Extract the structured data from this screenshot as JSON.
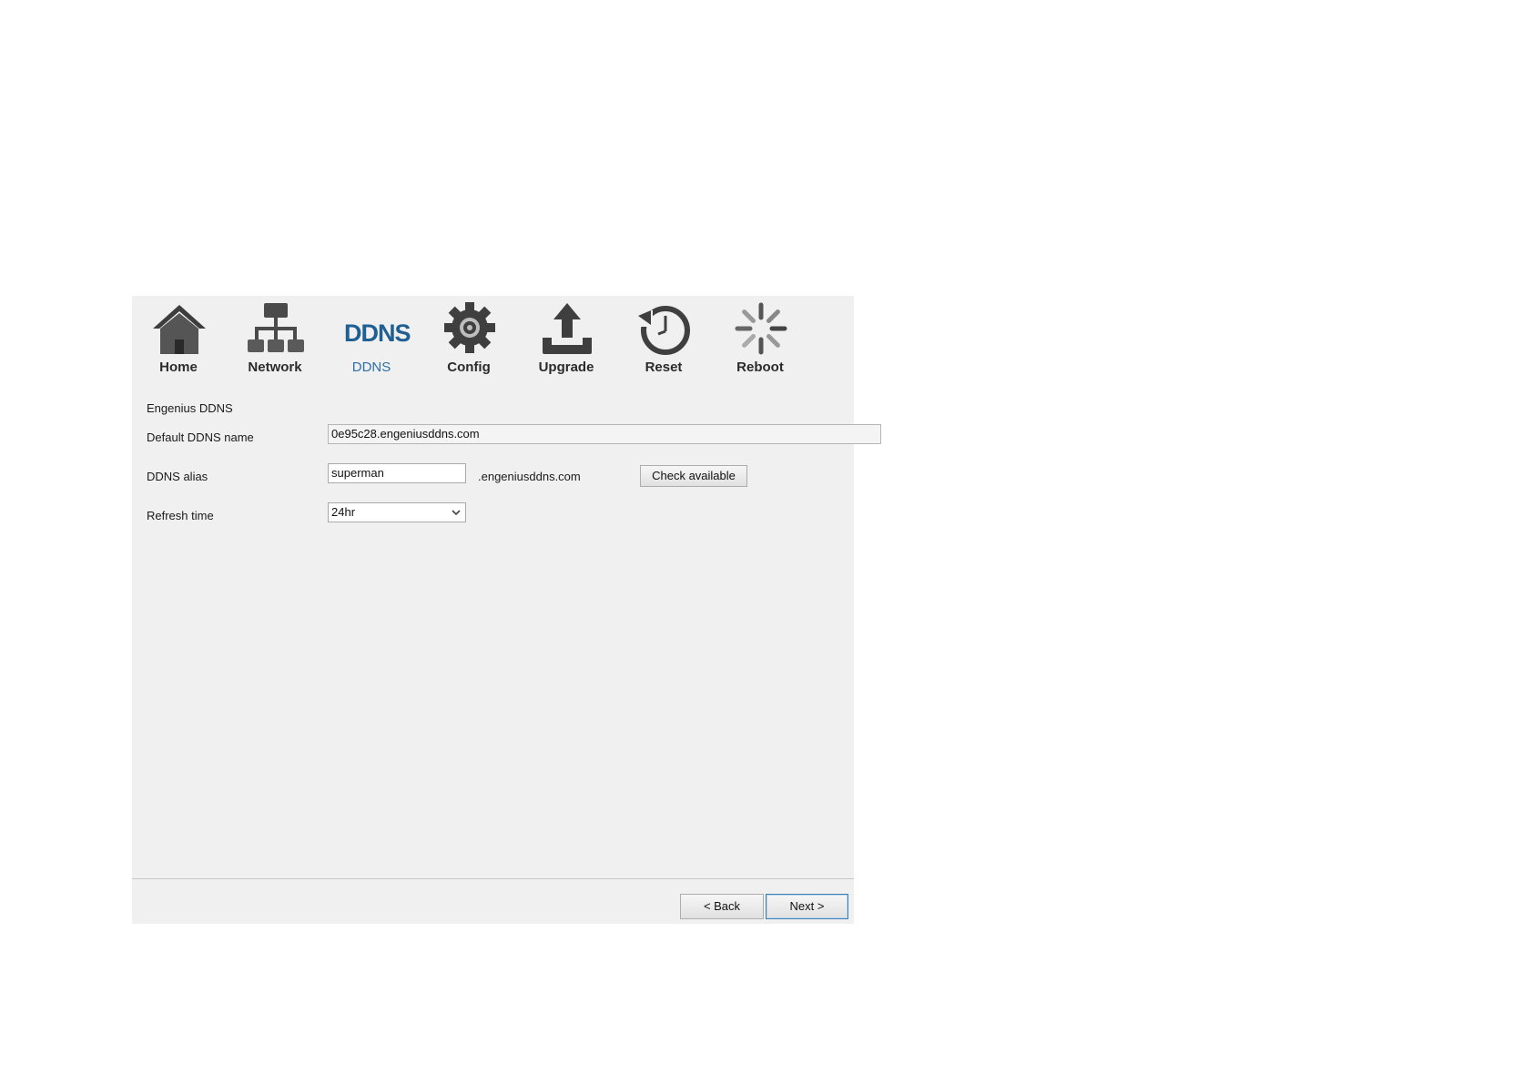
{
  "toolbar": {
    "items": [
      {
        "label": "Home",
        "icon": "home-icon"
      },
      {
        "label": "Network",
        "icon": "network-icon"
      },
      {
        "label": "DDNS",
        "icon": "ddns-icon",
        "icon_text": "DDNS",
        "active": true
      },
      {
        "label": "Config",
        "icon": "gear-icon"
      },
      {
        "label": "Upgrade",
        "icon": "upload-icon"
      },
      {
        "label": "Reset",
        "icon": "reset-icon"
      },
      {
        "label": "Reboot",
        "icon": "spinner-icon"
      }
    ]
  },
  "form": {
    "section_title": "Engenius DDNS",
    "default_name_label": "Default DDNS name",
    "default_name_value": "0e95c28.engeniusddns.com",
    "alias_label": "DDNS alias",
    "alias_value": "superman",
    "alias_suffix": ".engeniusddns.com",
    "check_button": "Check available",
    "refresh_label": "Refresh time",
    "refresh_value": "24hr"
  },
  "footer": {
    "back_button": "< Back",
    "next_button": "Next >"
  },
  "colors": {
    "panel_bg": "#f0f0f0",
    "active_label": "#2e6fa8",
    "ddns_logo": "#1f5f93",
    "icon_gray": "#4a4a4a"
  }
}
